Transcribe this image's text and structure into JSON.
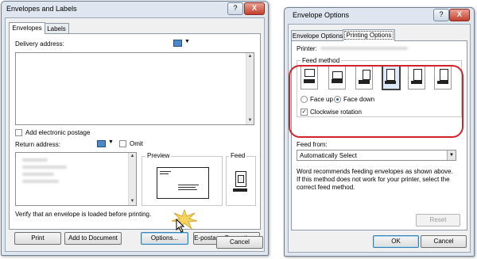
{
  "left_window": {
    "title": "Envelopes and Labels",
    "help_btn": "?",
    "close_btn": "X",
    "tabs": [
      {
        "label": "Envelopes"
      },
      {
        "label": "Labels"
      }
    ],
    "delivery_address_label": "Delivery address:",
    "add_postage_label": "Add electronic postage",
    "return_address_label": "Return address:",
    "omit_label": "Omit",
    "preview_label": "Preview",
    "feed_label": "Feed",
    "verify_text": "Verify that an envelope is loaded before printing.",
    "buttons": {
      "print": "Print",
      "add_to_document": "Add to Document",
      "options": "Options...",
      "epostage": "E-postage Properties...",
      "cancel": "Cancel"
    }
  },
  "right_window": {
    "title": "Envelope Options",
    "help_btn": "?",
    "close_btn": "X",
    "tabs": [
      {
        "label": "Envelope Options"
      },
      {
        "label": "Printing Options"
      }
    ],
    "printer_label": "Printer:",
    "feed_method_label": "Feed method",
    "face_up": "Face up",
    "face_down": "Face down",
    "face_down_selected": true,
    "clockwise_rotation": "Clockwise rotation",
    "clockwise_checked": true,
    "feed_from_label": "Feed from:",
    "feed_from_value": "Automatically Select",
    "info_text": [
      "Word recommends feeding envelopes as shown above.",
      "If this method does not work for your printer, select the",
      "correct feed method."
    ],
    "reset_label": "Reset",
    "ok_label": "OK",
    "cancel_label": "Cancel",
    "highlight_color": "#d2232a"
  }
}
